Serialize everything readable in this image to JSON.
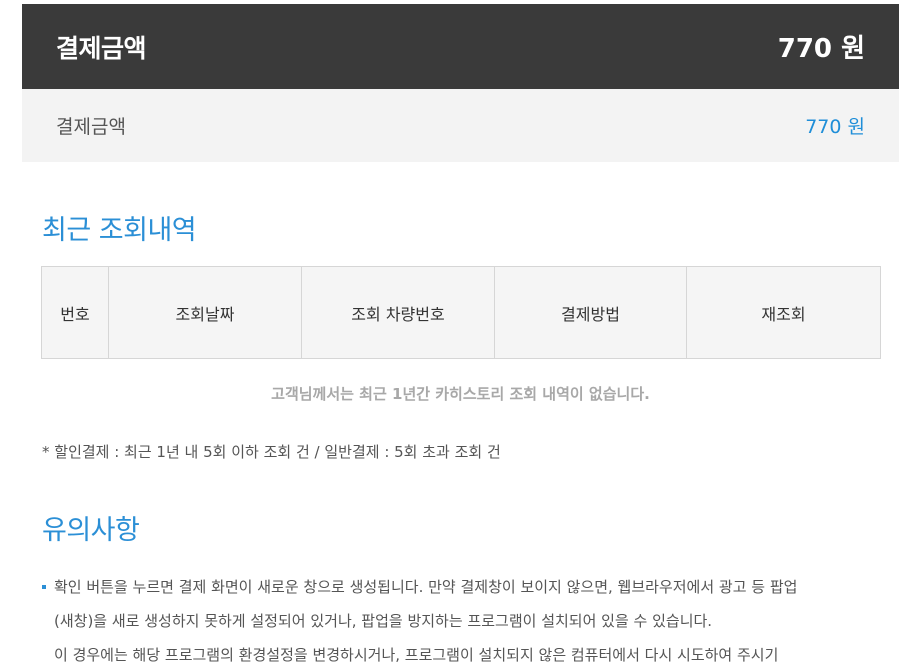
{
  "summary": {
    "total_label": "결제금액",
    "total_amount": "770 원",
    "sub_label": "결제금액",
    "sub_amount": "770 원"
  },
  "history": {
    "title": "최근 조회내역",
    "columns": [
      "번호",
      "조회날짜",
      "조회 차량번호",
      "결제방법",
      "재조회"
    ],
    "empty_message": "고객님께서는 최근 1년간 카히스토리 조회 내역이 없습니다.",
    "note": "* 할인결제 : 최근 1년 내 5회 이하 조회 건 / 일반결제 : 5회 초과 조회 건"
  },
  "notice": {
    "title": "유의사항",
    "lines": [
      "확인 버튼을 누르면 결제 화면이 새로운 창으로 생성됩니다. 만약 결제창이 보이지 않으면, 웹브라우저에서 광고 등 팝업",
      "(새창)을 새로 생성하지 못하게 설정되어 있거나, 팝업을 방지하는 프로그램이 설치되어 있을 수 있습니다.",
      "이 경우에는 해당 프로그램의 환경설정을 변경하시거나, 프로그램이 설치되지 않은 컴퓨터에서 다시 시도하여 주시기"
    ]
  },
  "colors": {
    "accent": "#2b8fd6",
    "header_bg": "#3a3a3a"
  }
}
